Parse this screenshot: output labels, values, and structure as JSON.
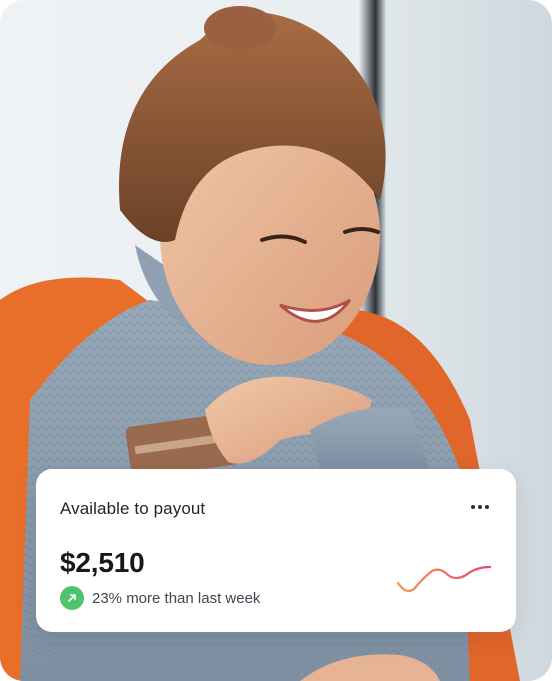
{
  "card": {
    "title": "Available to payout",
    "amount": "$2,510",
    "change_text": "23% more than last week",
    "menu_icon": "more-horizontal-icon",
    "trend_icon": "arrow-up-right-icon",
    "accent_positive": "#4fc46f",
    "sparkline_colors": [
      "#f59a46",
      "#e6457a"
    ]
  },
  "hero": {
    "description": "photo",
    "jacket_color": "#e86f2a",
    "sweater_color": "#8fa0b2"
  }
}
